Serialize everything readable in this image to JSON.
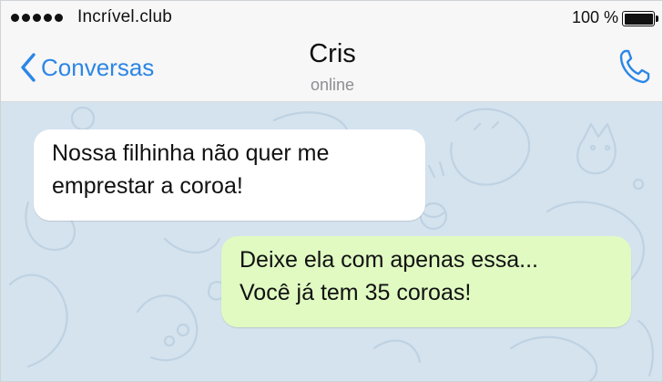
{
  "status_bar": {
    "carrier": "Incrível.club",
    "battery": "100 %",
    "battery_level": 1.0
  },
  "nav": {
    "back_label": "Conversas",
    "contact_name": "Cris",
    "contact_status": "online",
    "accent_color": "#2c86e6",
    "icons": [
      "chevron-left-icon",
      "phone-icon"
    ]
  },
  "messages": [
    {
      "direction": "incoming",
      "lines": [
        "Nossa filhinha não quer me",
        "emprestar a coroa!"
      ],
      "color": "#ffffff"
    },
    {
      "direction": "outgoing",
      "lines": [
        "Deixe ela com apenas essa...",
        "Você já tem 35 coroas!"
      ],
      "color": "#e0fac2"
    }
  ],
  "chat_background": "#d5e3ee"
}
